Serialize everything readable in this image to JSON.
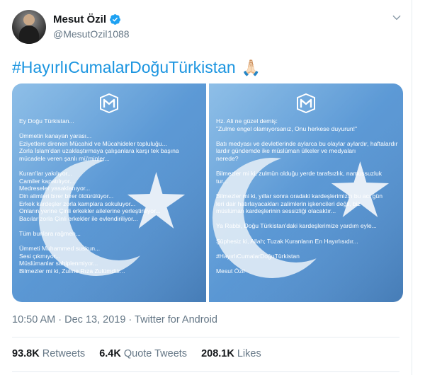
{
  "tweet": {
    "author_name": "Mesut Özil",
    "author_handle": "@MesutOzil1088",
    "hashtag": "#HayırlıCumalarDoğuTürkistan",
    "emoji": "🙏🏻",
    "timestamp": "10:50 AM · Dec 13, 2019 · Twitter for Android",
    "retweets_count": "93.8K",
    "retweets_label": "Retweets",
    "quote_count": "6.4K",
    "quote_label": "Quote Tweets",
    "likes_count": "208.1K",
    "likes_label": "Likes"
  },
  "icons": {
    "verified": "verified-badge-icon",
    "menu": "chevron-down-icon",
    "logo": "m-logo-icon"
  },
  "colors": {
    "link": "#1b95e0",
    "flag": "#5d9ad6",
    "secondary_text": "#657786"
  },
  "images": [
    {
      "lines": [
        "Ey Doğu Türkistan...",
        "",
        "Ümmetin kanayan yarası...",
        "Eziyetlere direnen Mücahid ve Mücahideler topluluğu...",
        "Zorla İslam'dan uzaklaştırmaya çalışanlara karşı tek başına",
        "mücadele veren şanlı mü'minler...",
        "",
        "Kuran'lar yakılıyor...",
        "Camiler kapatılıyor...",
        "Medreseler yasaklanıyor...",
        "Din alimleri birer birer öldürülüyor...",
        "Erkek kardeşler zorla kamplara sokuluyor...",
        "Onların yerine Çinli erkekler ailelerine yerleştiriliyor...",
        "Bacılar zorla Çinli erkekler ile evlendiriliyor...",
        "",
        "Tüm bunlara rağmen...",
        "",
        "Ümmeti Muhammed suskun...",
        "Sesi çıkmıyor...",
        "Müslümanlar sahiplenmiyor...",
        "Bilmezler mi ki, Zulme Rıza Zulümdür..."
      ]
    },
    {
      "lines": [
        "Hz. Ali ne güzel demiş:",
        "\"Zulme engel olamıyorsanız, Onu herkese duyurun!\"",
        "",
        "Batı medyası ve devletlerinde aylarca bu olaylar aylardır, haftalardır",
        "lardır gündemde ike müslüman ülkeler ve medyaları",
        "nerede?",
        "",
        "Bilmezler mi ki, zulmün olduğu yerde tarafsızlık, namussuzluk",
        "tur...",
        "",
        "Bilmezler mi ki, yıllar sonra oradaki kardeşlerimizin bu acı gün",
        "leri dair hatırlayacakları zalimlerin işkencileri değil, biz",
        "müslüman kardeşlerinin sessizliği olacaktır...",
        "",
        "Ya Rabbi, Doğu Türkistan'daki kardeşlerimize yardım eyle...",
        "",
        "Şüphesiz ki, Allah; Tuzak Kuranların En Hayırlısıdır...",
        "",
        "#HayırlıCumalarDoğuTürkistan",
        "",
        "Mesut Özil"
      ]
    }
  ]
}
